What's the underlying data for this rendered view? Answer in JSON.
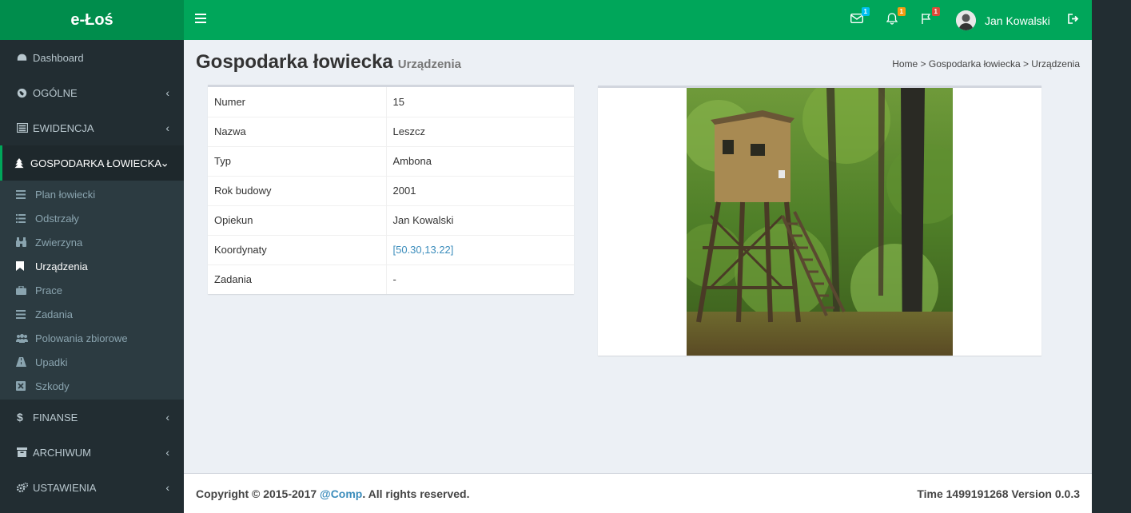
{
  "app": {
    "logo": "e-Łoś"
  },
  "header": {
    "user_name": "Jan Kowalski",
    "messages_count": "1",
    "notifications_count": "1",
    "tasks_count": "1",
    "badge_colors": {
      "messages": "#00c0ef",
      "notifications": "#f39c12",
      "tasks": "#dd4b39"
    }
  },
  "sidebar": {
    "items": [
      {
        "label": "Dashboard",
        "icon": "dashboard-icon",
        "has_chevron": false
      },
      {
        "label": "OGÓLNE",
        "icon": "globe-icon",
        "has_chevron": true
      },
      {
        "label": "EWIDENCJA",
        "icon": "list-alt-icon",
        "has_chevron": true
      },
      {
        "label": "GOSPODARKA ŁOWIECKA",
        "icon": "tree-icon",
        "has_chevron": true,
        "expanded": true
      },
      {
        "label": "FINANSE",
        "icon": "dollar-icon",
        "has_chevron": true
      },
      {
        "label": "ARCHIWUM",
        "icon": "archive-icon",
        "has_chevron": true
      },
      {
        "label": "USTAWIENIA",
        "icon": "cogs-icon",
        "has_chevron": true
      }
    ],
    "submenu": [
      {
        "label": "Plan łowiecki",
        "icon": "bars-icon"
      },
      {
        "label": "Odstrzały",
        "icon": "list-icon"
      },
      {
        "label": "Zwierzyna",
        "icon": "binoculars-icon"
      },
      {
        "label": "Urządzenia",
        "icon": "bookmark-icon",
        "active": true
      },
      {
        "label": "Prace",
        "icon": "briefcase-icon"
      },
      {
        "label": "Zadania",
        "icon": "tasks-icon"
      },
      {
        "label": "Polowania zbiorowe",
        "icon": "users-icon"
      },
      {
        "label": "Upadki",
        "icon": "road-icon"
      },
      {
        "label": "Szkody",
        "icon": "close-box-icon"
      }
    ]
  },
  "page": {
    "title": "Gospodarka łowiecka",
    "subtitle": "Urządzenia",
    "breadcrumb": "Home > Gospodarka łowiecka > Urządzenia"
  },
  "details": {
    "rows": [
      {
        "label": "Numer",
        "value": "15"
      },
      {
        "label": "Nazwa",
        "value": "Leszcz"
      },
      {
        "label": "Typ",
        "value": "Ambona"
      },
      {
        "label": "Rok budowy",
        "value": "2001"
      },
      {
        "label": "Opiekun",
        "value": "Jan Kowalski"
      },
      {
        "label": "Koordynaty",
        "value": "[50.30,13.22]",
        "link": true
      },
      {
        "label": "Zadania",
        "value": "-"
      }
    ]
  },
  "footer": {
    "copyright_prefix": "Copyright © 2015-2017 ",
    "company": "@Comp",
    "copyright_suffix": ". All rights reserved.",
    "time_label": "Time 1499191268 Version 0.0.3"
  }
}
